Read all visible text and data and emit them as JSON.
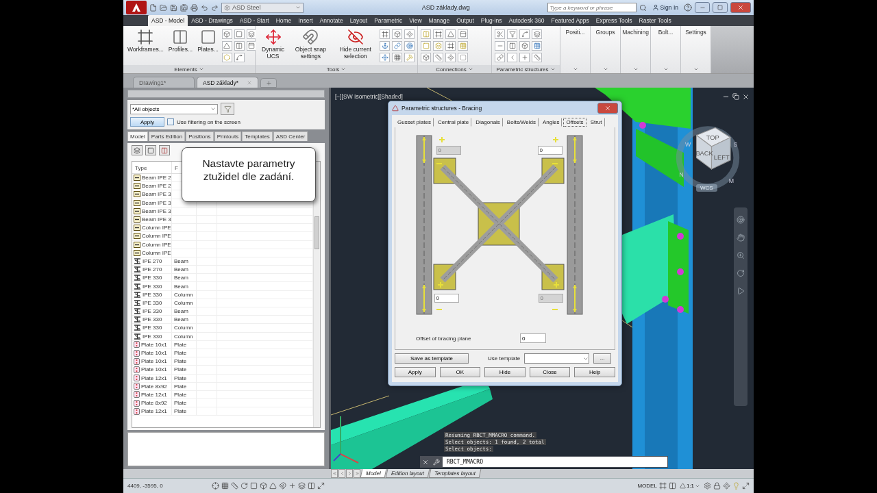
{
  "title_bar": {
    "workspace": "ASD Steel",
    "title": "ASD základy.dwg",
    "search": {
      "placeholder": "Type a keyword or phrase"
    },
    "sign_in": "Sign In"
  },
  "ribbon_tabs": [
    {
      "label": "ASD - Model",
      "selected": true
    },
    {
      "label": "ASD - Drawings",
      "selected": false
    },
    {
      "label": "ASD - Start",
      "selected": false
    },
    {
      "label": "Home",
      "selected": false
    },
    {
      "label": "Insert",
      "selected": false
    },
    {
      "label": "Annotate",
      "selected": false
    },
    {
      "label": "Layout",
      "selected": false
    },
    {
      "label": "Parametric",
      "selected": false
    },
    {
      "label": "View",
      "selected": false
    },
    {
      "label": "Manage",
      "selected": false
    },
    {
      "label": "Output",
      "selected": false
    },
    {
      "label": "Plug-ins",
      "selected": false
    },
    {
      "label": "Autodesk 360",
      "selected": false
    },
    {
      "label": "Featured Apps",
      "selected": false
    },
    {
      "label": "Express Tools",
      "selected": false
    },
    {
      "label": "Raster Tools",
      "selected": false
    }
  ],
  "ribbon_panels": [
    {
      "kind": "large",
      "label": "Elements",
      "buttons": [
        "Workframes...",
        "Profiles...",
        "Plates..."
      ]
    },
    {
      "kind": "large",
      "label": "Tools",
      "buttons": [
        "Dynamic UCS",
        "Object snap settings",
        "Hide current selection"
      ]
    },
    {
      "kind": "icons",
      "label": "Connections"
    },
    {
      "kind": "icons",
      "label": "Parametric structures"
    },
    {
      "kind": "collapsed",
      "label": "Positi..."
    },
    {
      "kind": "collapsed",
      "label": "Groups"
    },
    {
      "kind": "collapsed",
      "label": "Machining"
    },
    {
      "kind": "collapsed",
      "label": "Bolt..."
    },
    {
      "kind": "collapsed",
      "label": "Settings"
    }
  ],
  "document_tabs": [
    {
      "label": "Drawing1*",
      "selected": false
    },
    {
      "label": "ASD základy*",
      "selected": true
    }
  ],
  "object_panel": {
    "filter": "*All objects",
    "apply": "Apply",
    "filter_on_screen": {
      "label": "Use filtering on the screen",
      "checked": false
    },
    "tabs": [
      {
        "label": "Model",
        "selected": true
      },
      {
        "label": "Parts Edition",
        "selected": false
      },
      {
        "label": "Positions",
        "selected": false
      },
      {
        "label": "Printouts",
        "selected": false
      },
      {
        "label": "Templates",
        "selected": false
      },
      {
        "label": "ASD Center",
        "selected": false
      }
    ],
    "columns": [
      "Type",
      "F"
    ],
    "rows": [
      {
        "kind": "group",
        "type": "Beam IPE 2"
      },
      {
        "kind": "group",
        "type": "Beam IPE 2"
      },
      {
        "kind": "group",
        "type": "Beam IPE 3"
      },
      {
        "kind": "group",
        "type": "Beam IPE 3"
      },
      {
        "kind": "group",
        "type": "Beam IPE 3"
      },
      {
        "kind": "group",
        "type": "Beam IPE 3"
      },
      {
        "kind": "group",
        "type": "Column IPE"
      },
      {
        "kind": "group",
        "type": "Column IPE"
      },
      {
        "kind": "group",
        "type": "Column IPE"
      },
      {
        "kind": "group",
        "type": "Column IPE"
      },
      {
        "kind": "profile",
        "type": "IPE 270",
        "column_2": "Beam"
      },
      {
        "kind": "profile",
        "type": "IPE 270",
        "column_2": "Beam"
      },
      {
        "kind": "profile",
        "type": "IPE 330",
        "column_2": "Beam"
      },
      {
        "kind": "profile",
        "type": "IPE 330",
        "column_2": "Beam"
      },
      {
        "kind": "profile",
        "type": "IPE 330",
        "column_2": "Column"
      },
      {
        "kind": "profile",
        "type": "IPE 330",
        "column_2": "Column"
      },
      {
        "kind": "profile",
        "type": "IPE 330",
        "column_2": "Beam"
      },
      {
        "kind": "profile",
        "type": "IPE 330",
        "column_2": "Beam"
      },
      {
        "kind": "profile",
        "type": "IPE 330",
        "column_2": "Column"
      },
      {
        "kind": "profile",
        "type": "IPE 330",
        "column_2": "Column"
      },
      {
        "kind": "plate",
        "type": "Plate 10x1",
        "column_2": "Plate"
      },
      {
        "kind": "plate",
        "type": "Plate 10x1",
        "column_2": "Plate"
      },
      {
        "kind": "plate",
        "type": "Plate 10x1",
        "column_2": "Plate"
      },
      {
        "kind": "plate",
        "type": "Plate 10x1",
        "column_2": "Plate"
      },
      {
        "kind": "plate",
        "type": "Plate 12x1",
        "column_2": "Plate"
      },
      {
        "kind": "plate",
        "type": "Plate 8x92",
        "column_2": "Plate"
      },
      {
        "kind": "plate",
        "type": "Plate 12x1",
        "column_2": "Plate"
      },
      {
        "kind": "plate",
        "type": "Plate 8x92",
        "column_2": "Plate"
      },
      {
        "kind": "plate",
        "type": "Plate 12x1",
        "column_2": "Plate"
      }
    ]
  },
  "callout": "Nastavte parametry ztužidel dle zadání.",
  "viewport": {
    "label": "[−][SW Isometric][Shaded]",
    "view_cube": {
      "faces": [
        "TOP",
        "BACK",
        "LEFT"
      ],
      "compass": [
        "W",
        "S",
        "N",
        "M"
      ],
      "coordinate_system": "WCS"
    },
    "command_history": [
      "Resuming RBCT_MMACRO command.",
      "Select objects: 1 found, 2 total",
      "Select objects:"
    ],
    "command": "RBCT_MMACRO"
  },
  "dialog": {
    "title": "Parametric structures - Bracing",
    "tabs": [
      {
        "label": "Gusset plates",
        "selected": false
      },
      {
        "label": "Central plate",
        "selected": false
      },
      {
        "label": "Diagonals",
        "selected": false
      },
      {
        "label": "Bolts/Welds",
        "selected": false
      },
      {
        "label": "Angles",
        "selected": false
      },
      {
        "label": "Offsets",
        "selected": true
      },
      {
        "label": "Strut",
        "selected": false
      }
    ],
    "offsets": [
      {
        "value": "0",
        "disabled": true
      },
      {
        "value": "0",
        "disabled": false
      },
      {
        "value": "0",
        "disabled": false
      },
      {
        "value": "0",
        "disabled": true
      }
    ],
    "plane_offset": {
      "label": "Offset of bracing plane",
      "value": "0"
    },
    "save_template": "Save as template",
    "use_template": "Use template",
    "browse": "...",
    "buttons": [
      "Apply",
      "OK",
      "Hide",
      "Close",
      "Help"
    ]
  },
  "layout_tabs": [
    {
      "label": "Model",
      "selected": true
    },
    {
      "label": "Edition layout",
      "selected": false
    },
    {
      "label": "Templates layout",
      "selected": false
    }
  ],
  "status_bar": {
    "coordinates": "4409, -3595, 0",
    "space": "MODEL",
    "scale": "1:1"
  }
}
